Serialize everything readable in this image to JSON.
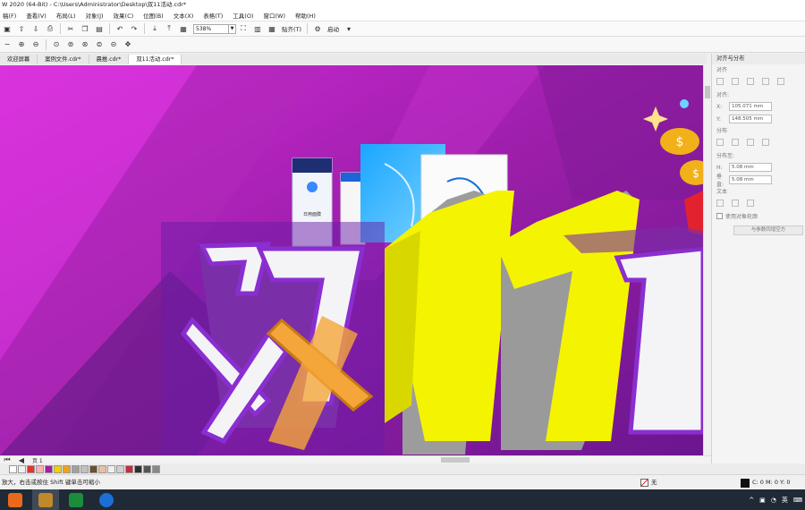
{
  "window": {
    "title": "W 2020 (64-Bit) - C:\\Users\\Administrator\\Desktop\\双11活动.cdr*"
  },
  "menu": [
    "稿(F)",
    "查看(V)",
    "布局(L)",
    "对象(J)",
    "效果(C)",
    "位图(B)",
    "文本(X)",
    "表格(T)",
    "工具(O)",
    "窗口(W)",
    "帮助(H)"
  ],
  "toolbar": {
    "zoom": "538%",
    "snap_label": "贴齐(T)",
    "launch_label": "启动"
  },
  "tabs": [
    "欢迎屏幕",
    "案例文件.cdr*",
    "晨推.cdr*",
    "双11活动.cdr*"
  ],
  "canvas": {
    "main_text_1": "双",
    "main_text_2": "11",
    "main_text_3": "川",
    "product_label": "日用面膜"
  },
  "page_nav": {
    "page": "页 1"
  },
  "docker": {
    "title": "对齐与分布",
    "section_align": "对齐",
    "align_to": "对齐:",
    "x_label": "X:",
    "x_value": "105.071 mm",
    "y_label": "Y:",
    "y_value": "148.505 mm",
    "section_distribute": "分布",
    "distribute_to": "分布至:",
    "h_label": "H:",
    "h_value": "5.08 mm",
    "v_label": "垂直:",
    "v_value": "5.08 mm",
    "section_text": "文本",
    "use_object_label": "使用对象轮廓",
    "page_button": "与参数同增空方"
  },
  "palette": [
    "#ffffff",
    "#f0f0f0",
    "#e83030",
    "#ffb0b0",
    "#a020a0",
    "#f0d000",
    "#f2a020",
    "#a0a0a0",
    "#c0c0c0",
    "#6a5030",
    "#e8c0a0",
    "#f0f0f0",
    "#d0d0d0",
    "#c03040",
    "#303030",
    "#555555",
    "#888888"
  ],
  "status": {
    "hint": "放大，右击或按住 Shift 键单击可缩小",
    "fill_label": "无",
    "stroke_label": "C: 0 M: 0 Y: 0"
  },
  "taskbar": {
    "ime": "英"
  }
}
